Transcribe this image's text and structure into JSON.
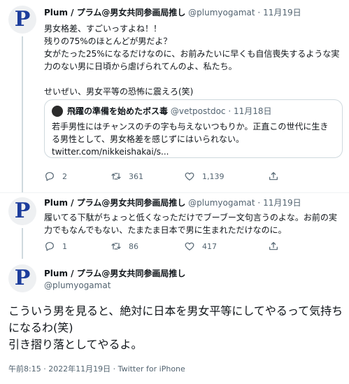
{
  "tweets": [
    {
      "author_name": "Plum / プラム@男女共同参画局推し",
      "handle": "@plumyogamat",
      "separator": "·",
      "time": "11月19日",
      "avatar_letter": "P",
      "text": "男女格差、すごいっすよね！！\n残りの75%のほとんどが男だよ？\n女がたった25%になるだけなのに、お前みたいに早くも自信喪失するような実力のない男に日頃から虐げられてんのよ、私たち。\n\nせいぜい、男女平等の恐怖に震えろ(笑)",
      "quote": {
        "author_name": "飛躍の準備を始めたボス毒",
        "handle": "@vetpostdoc",
        "separator": "·",
        "time": "11月18日",
        "text": "若手男性にはチャンスのチの字も与えないつもりか。正直この世代に生きる男性として、男女格差を感じずにはいられない。\ntwitter.com/nikkeishakai/s..."
      },
      "replies": "2",
      "retweets": "361",
      "likes": "1,139"
    },
    {
      "author_name": "Plum / プラム@男女共同参画局推し",
      "handle": "@plumyogamat",
      "separator": "·",
      "time": "11月19日",
      "avatar_letter": "P",
      "text": "履いてる下駄がちょっと低くなっただけでブーブー文句言うのよな。お前の実力でもなんでもない、たまたま日本で男に生まれただけなのに。",
      "replies": "1",
      "retweets": "86",
      "likes": "417"
    }
  ],
  "main_tweet": {
    "author_name": "Plum / プラム@男女共同参画局推し",
    "handle": "@plumyogamat",
    "avatar_letter": "P",
    "text": "こういう男を見ると、絶対に日本を男女平等にしてやるって気持ちになるわ(笑)\n引き摺り落としてやるよ。",
    "meta": "午前8:15 · 2022年11月19日 · Twitter for iPhone"
  }
}
